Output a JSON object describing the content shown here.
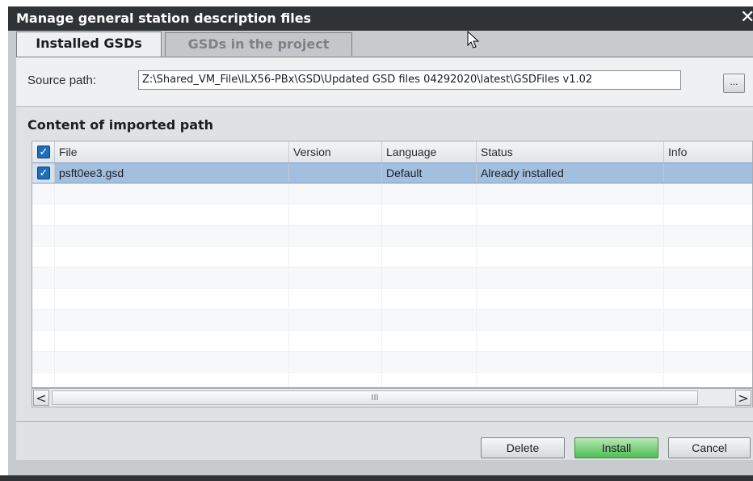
{
  "dialog": {
    "title": "Manage general station description files",
    "close_glyph": "✕"
  },
  "tabs": [
    {
      "label": "Installed GSDs",
      "active": true
    },
    {
      "label": "GSDs in the project",
      "active": false
    }
  ],
  "source": {
    "label": "Source path:",
    "value": "Z:\\Shared_VM_File\\ILX56-PBx\\GSD\\Updated GSD files 04292020\\latest\\GSDFiles v1.02",
    "browse_label": "..."
  },
  "content": {
    "header": "Content of imported path",
    "columns": [
      "File",
      "Version",
      "Language",
      "Status",
      "Info"
    ],
    "header_checked": true,
    "rows": [
      {
        "checked": true,
        "file": "psft0ee3.gsd",
        "version": "",
        "language": "Default",
        "status": "Already installed",
        "info": ""
      }
    ]
  },
  "scrollbar": {
    "left_arrow": "<",
    "right_arrow": ">",
    "thumb_grip": "III"
  },
  "buttons": {
    "delete": "Delete",
    "install": "Install",
    "cancel": "Cancel"
  },
  "icons": {
    "close": "close-icon",
    "checkbox": "checkbox-icon",
    "mouse_cursor": "mouse-cursor-icon"
  },
  "colors": {
    "titlebar": "#2f3335",
    "selected_row": "#a3bfe0",
    "install_button": "#4fbf54",
    "checkbox": "#1e6fb8"
  }
}
